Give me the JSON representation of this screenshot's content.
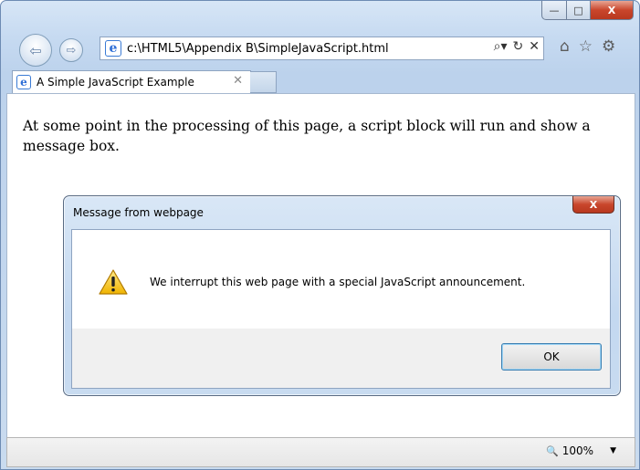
{
  "browser": {
    "address": "c:\\HTML5\\Appendix B\\SimpleJavaScript.html",
    "address_icons": {
      "search": "⌕▾",
      "refresh": "↻",
      "stop": "✕"
    },
    "tab_title": "A Simple JavaScript Example",
    "tab_close": "✕",
    "caption": {
      "minimize": "—",
      "maximize": "□",
      "close": "X"
    },
    "tool_icons": {
      "home": "⌂",
      "favorites": "☆",
      "tools": "⚙"
    }
  },
  "page": {
    "paragraph": "At some point in the processing of this page, a script block will run and show a message box."
  },
  "dialog": {
    "title": "Message from webpage",
    "close": "X",
    "message": "We interrupt this web page with a special JavaScript announcement.",
    "ok_label": "OK"
  },
  "status": {
    "zoom": "100%",
    "zoom_icon": "🔍",
    "zoom_dropdown": "▼"
  },
  "colors": {
    "frame": "#c6daf1",
    "close_red": "#c9462c",
    "ok_focus": "#3c7fb1"
  }
}
